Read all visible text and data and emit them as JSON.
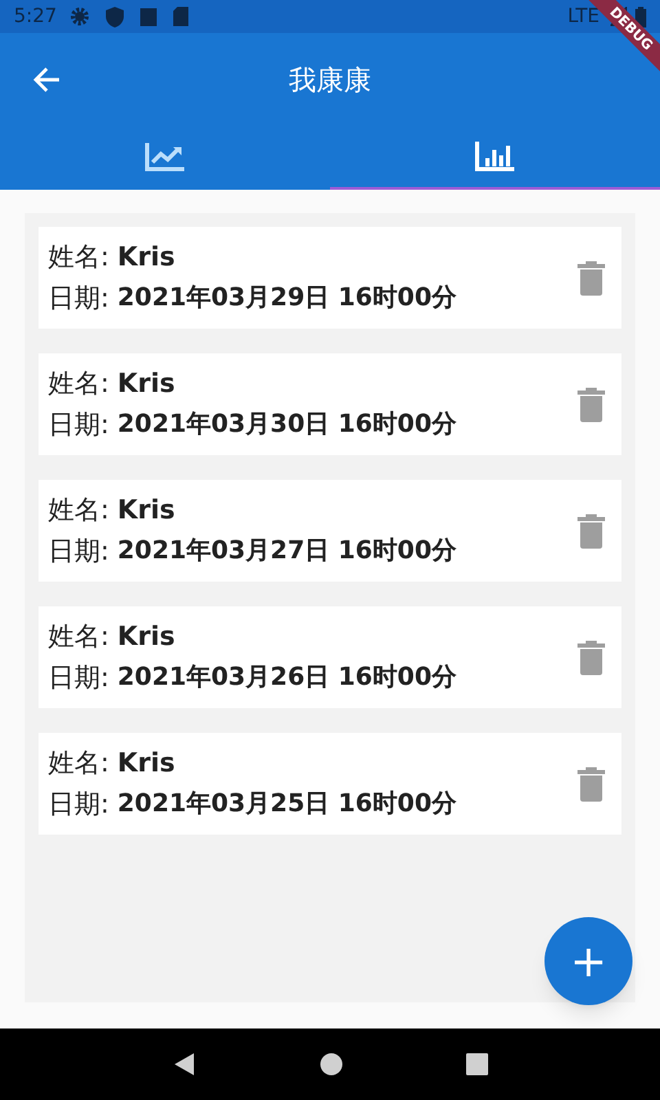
{
  "status_bar": {
    "time": "5:27",
    "network": "LTE"
  },
  "debug_banner": "DEBUG",
  "app_bar": {
    "title": "我康康"
  },
  "tabs": [
    {
      "kind": "line",
      "selected": false
    },
    {
      "kind": "bar",
      "selected": true
    }
  ],
  "records": [
    {
      "name_label": "姓名:",
      "name": "Kris",
      "date_label": "日期:",
      "date": "2021年03月29日 16时00分"
    },
    {
      "name_label": "姓名:",
      "name": "Kris",
      "date_label": "日期:",
      "date": "2021年03月30日 16时00分"
    },
    {
      "name_label": "姓名:",
      "name": "Kris",
      "date_label": "日期:",
      "date": "2021年03月27日 16时00分"
    },
    {
      "name_label": "姓名:",
      "name": "Kris",
      "date_label": "日期:",
      "date": "2021年03月26日 16时00分"
    },
    {
      "name_label": "姓名:",
      "name": "Kris",
      "date_label": "日期:",
      "date": "2021年03月25日 16时00分"
    }
  ],
  "fab": "+"
}
